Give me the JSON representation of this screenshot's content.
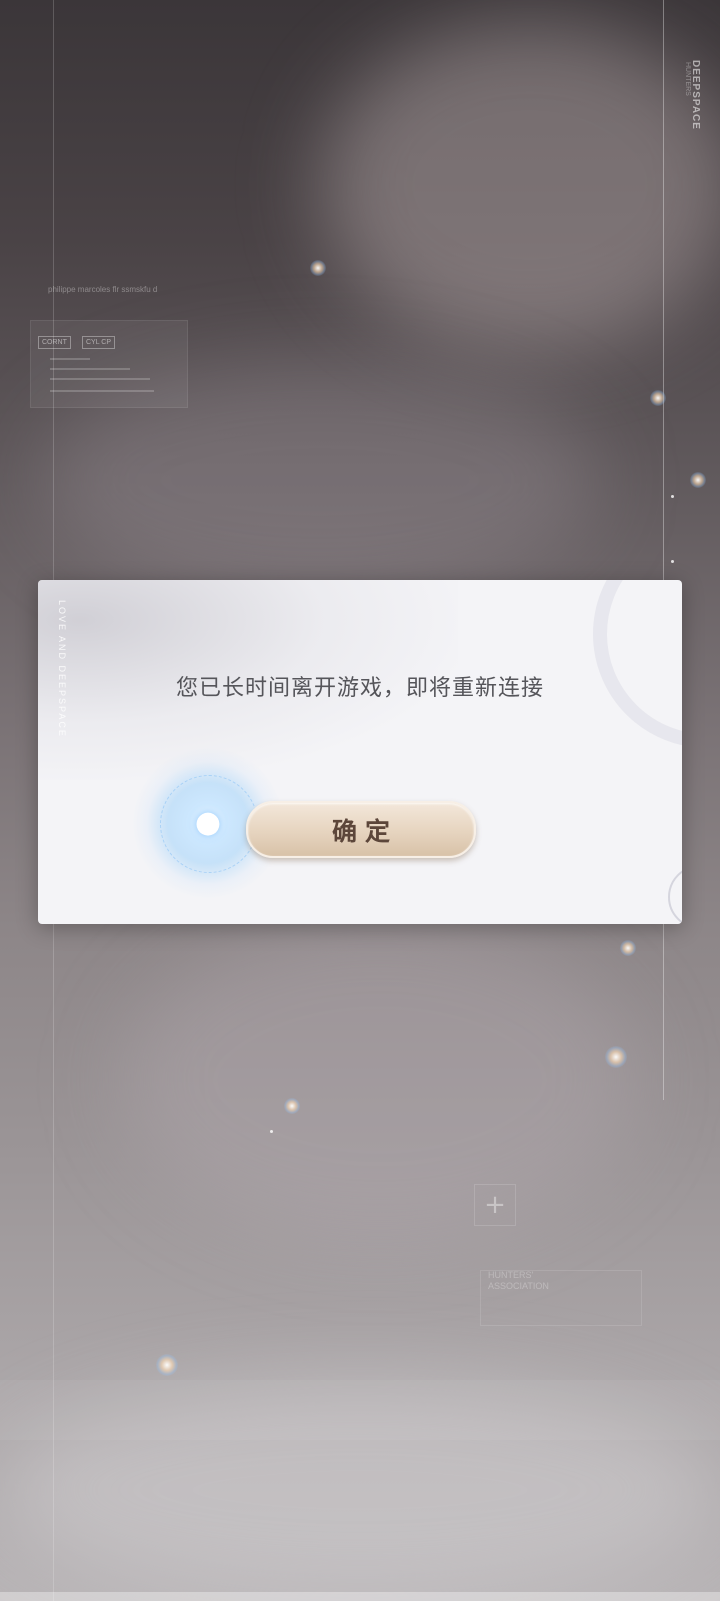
{
  "background": {
    "brand_vertical": "DEEPSPACE",
    "brand_sub": "HUNTERS",
    "hud": {
      "text": "philippe marcoles flr ssmskfu d",
      "tag_1": "CORNT",
      "tag_2": "CYL CP"
    },
    "bottom": {
      "plus": "+",
      "association": "HUNTERS' ASSOCIATION"
    }
  },
  "dialog": {
    "side_text": "LOVE AND DEEPSPACE",
    "message": "您已长时间离开游戏，即将重新连接",
    "confirm_label": "确定",
    "colors": {
      "panel": "#f4f4f7",
      "message_text": "#55555a",
      "button_text": "#5c463a"
    }
  },
  "icons": {
    "glow_orb": "glowing-companion-orb-icon",
    "plus": "plus-icon"
  }
}
